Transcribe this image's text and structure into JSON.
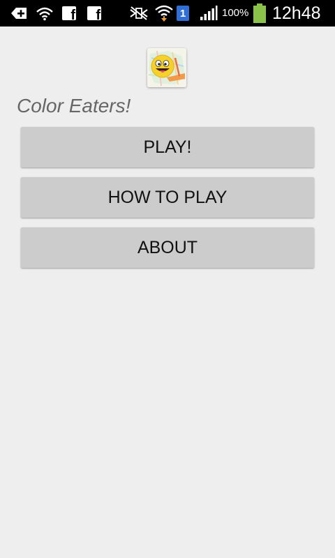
{
  "status_bar": {
    "icons": [
      "usb-download-icon",
      "wifi-hotspot-icon",
      "facebook-icon",
      "facebook-icon",
      "silent-mode-icon",
      "wifi-icon",
      "sim-1-icon",
      "signal-icon",
      "battery-icon"
    ],
    "sim_slot": "1",
    "fb_letter": "f",
    "battery_percent": "100%",
    "time": "12h48",
    "battery_color": "#8bc34a"
  },
  "app": {
    "title": "Color Eaters!",
    "icon": "color-eaters-smiley-icon"
  },
  "menu": {
    "play_label": "PLAY!",
    "how_to_play_label": "HOW TO PLAY",
    "about_label": "ABOUT"
  },
  "colors": {
    "background": "#eeeeee",
    "button": "#cccccc",
    "title_text": "#666666"
  }
}
